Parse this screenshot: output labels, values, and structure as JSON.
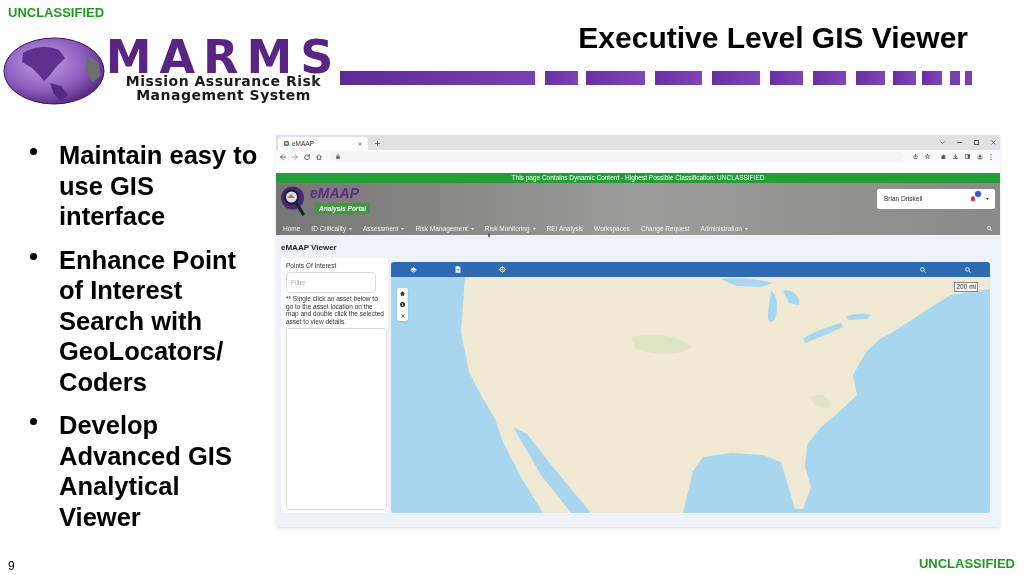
{
  "slide": {
    "classification_top": "UNCLASSIFIED",
    "logo": {
      "wordmark": "MARMS",
      "subtitle_lines": [
        "Mission Assurance Risk",
        "Management System"
      ]
    },
    "title": "Executive Level GIS Viewer",
    "bullets": [
      "Maintain easy to use GIS interface",
      "Enhance Point of Interest Search with GeoLocators/ Coders",
      "Develop Advanced GIS Analytical Viewer"
    ],
    "page_number": "9",
    "classification_bottom": "UNCLASSIFIED"
  },
  "browser": {
    "tabs": [
      {
        "label": "eMAAP",
        "selected": true
      }
    ]
  },
  "app": {
    "banner": "This page Contains Dynamic Content - Highest Possible Classification: UNCLASSIFIED",
    "logo": {
      "wordmark": "eMAAP",
      "tagline": "Analysis Portal"
    },
    "user": {
      "name": "Brian Driskell"
    },
    "nav": [
      {
        "label": "Home",
        "dropdown": false
      },
      {
        "label": "ID Criticality",
        "dropdown": true
      },
      {
        "label": "Assessment",
        "dropdown": true
      },
      {
        "label": "Risk Management",
        "dropdown": true
      },
      {
        "label": "Risk Monitoring",
        "dropdown": true
      },
      {
        "label": "REI Analysis",
        "dropdown": false
      },
      {
        "label": "Workspaces",
        "dropdown": false
      },
      {
        "label": "Change Request",
        "dropdown": false
      },
      {
        "label": "Administration",
        "dropdown": true
      }
    ],
    "page_title": "eMAAP Viewer",
    "poi_panel": {
      "title": "Points Of Interest",
      "filter": {
        "placeholder": "Filter"
      },
      "note": "** Single click an asset below to go to the asset location on the map and double click the selected asset to view details."
    },
    "map": {
      "scale": "200 mi"
    }
  }
}
